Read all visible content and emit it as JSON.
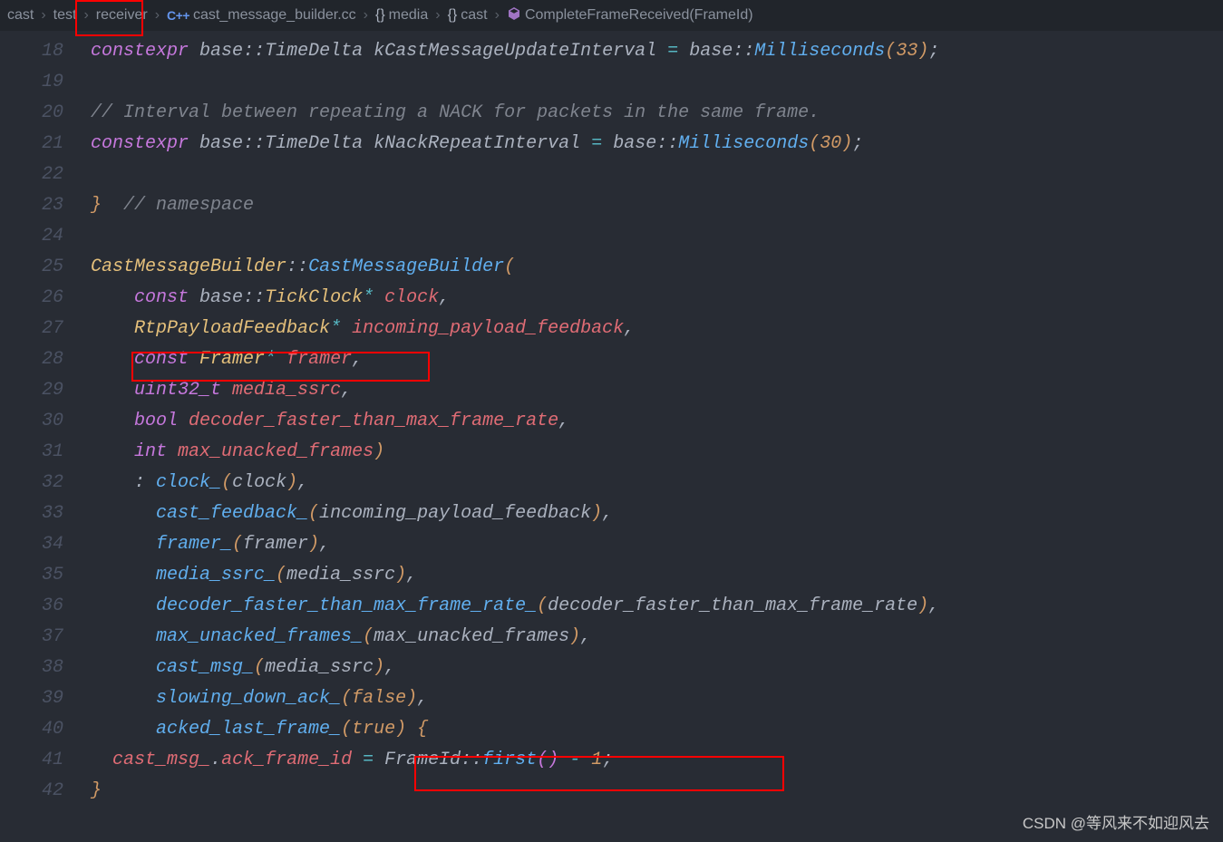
{
  "breadcrumb": {
    "items": [
      {
        "label": "cast",
        "icon": ""
      },
      {
        "label": "test",
        "icon": ""
      },
      {
        "label": "receiver",
        "icon": ""
      },
      {
        "label": "cast_message_builder.cc",
        "icon": "cpp"
      },
      {
        "label": "media",
        "icon": "brace"
      },
      {
        "label": "cast",
        "icon": "brace"
      },
      {
        "label": "CompleteFrameReceived(FrameId)",
        "icon": "cube"
      }
    ]
  },
  "lines": [
    {
      "num": "18",
      "tokens": [
        {
          "c": "kw",
          "t": "constexpr"
        },
        {
          "c": "punc",
          "t": " "
        },
        {
          "c": "plain",
          "t": "base"
        },
        {
          "c": "punc",
          "t": "::"
        },
        {
          "c": "plain",
          "t": "TimeDelta"
        },
        {
          "c": "punc",
          "t": " "
        },
        {
          "c": "plain",
          "t": "kCastMessageUpdateInterval"
        },
        {
          "c": "punc",
          "t": " "
        },
        {
          "c": "op",
          "t": "="
        },
        {
          "c": "punc",
          "t": " "
        },
        {
          "c": "plain",
          "t": "base"
        },
        {
          "c": "punc",
          "t": "::"
        },
        {
          "c": "func",
          "t": "Milliseconds"
        },
        {
          "c": "brace1",
          "t": "("
        },
        {
          "c": "num",
          "t": "33"
        },
        {
          "c": "brace1",
          "t": ")"
        },
        {
          "c": "punc",
          "t": ";"
        }
      ]
    },
    {
      "num": "19",
      "tokens": []
    },
    {
      "num": "20",
      "tokens": [
        {
          "c": "cmt",
          "t": "// Interval between repeating a NACK for packets in the same frame."
        }
      ]
    },
    {
      "num": "21",
      "tokens": [
        {
          "c": "kw",
          "t": "constexpr"
        },
        {
          "c": "punc",
          "t": " "
        },
        {
          "c": "plain",
          "t": "base"
        },
        {
          "c": "punc",
          "t": "::"
        },
        {
          "c": "plain",
          "t": "TimeDelta"
        },
        {
          "c": "punc",
          "t": " "
        },
        {
          "c": "plain",
          "t": "kNackRepeatInterval"
        },
        {
          "c": "punc",
          "t": " "
        },
        {
          "c": "op",
          "t": "="
        },
        {
          "c": "punc",
          "t": " "
        },
        {
          "c": "plain",
          "t": "base"
        },
        {
          "c": "punc",
          "t": "::"
        },
        {
          "c": "func",
          "t": "Milliseconds"
        },
        {
          "c": "brace1",
          "t": "("
        },
        {
          "c": "num",
          "t": "30"
        },
        {
          "c": "brace1",
          "t": ")"
        },
        {
          "c": "punc",
          "t": ";"
        }
      ]
    },
    {
      "num": "22",
      "tokens": []
    },
    {
      "num": "23",
      "tokens": [
        {
          "c": "brace1",
          "t": "}"
        },
        {
          "c": "punc",
          "t": "  "
        },
        {
          "c": "cmt",
          "t": "// namespace"
        }
      ]
    },
    {
      "num": "24",
      "tokens": []
    },
    {
      "num": "25",
      "tokens": [
        {
          "c": "type",
          "t": "CastMessageBuilder"
        },
        {
          "c": "punc",
          "t": "::"
        },
        {
          "c": "func",
          "t": "CastMessageBuilder"
        },
        {
          "c": "brace1",
          "t": "("
        }
      ]
    },
    {
      "num": "26",
      "tokens": [
        {
          "c": "punc",
          "t": "    "
        },
        {
          "c": "kw",
          "t": "const"
        },
        {
          "c": "punc",
          "t": " "
        },
        {
          "c": "plain",
          "t": "base"
        },
        {
          "c": "punc",
          "t": "::"
        },
        {
          "c": "type",
          "t": "TickClock"
        },
        {
          "c": "op",
          "t": "*"
        },
        {
          "c": "punc",
          "t": " "
        },
        {
          "c": "var",
          "t": "clock"
        },
        {
          "c": "punc",
          "t": ","
        }
      ]
    },
    {
      "num": "27",
      "tokens": [
        {
          "c": "punc",
          "t": "    "
        },
        {
          "c": "type",
          "t": "RtpPayloadFeedback"
        },
        {
          "c": "op",
          "t": "*"
        },
        {
          "c": "punc",
          "t": " "
        },
        {
          "c": "var",
          "t": "incoming_payload_feedback"
        },
        {
          "c": "punc",
          "t": ","
        }
      ]
    },
    {
      "num": "28",
      "tokens": [
        {
          "c": "punc",
          "t": "    "
        },
        {
          "c": "kw",
          "t": "const"
        },
        {
          "c": "punc",
          "t": " "
        },
        {
          "c": "type",
          "t": "Framer"
        },
        {
          "c": "op",
          "t": "*"
        },
        {
          "c": "punc",
          "t": " "
        },
        {
          "c": "var",
          "t": "framer"
        },
        {
          "c": "punc",
          "t": ","
        }
      ]
    },
    {
      "num": "29",
      "tokens": [
        {
          "c": "punc",
          "t": "    "
        },
        {
          "c": "kw",
          "t": "uint32_t"
        },
        {
          "c": "punc",
          "t": " "
        },
        {
          "c": "var",
          "t": "media_ssrc"
        },
        {
          "c": "punc",
          "t": ","
        }
      ]
    },
    {
      "num": "30",
      "tokens": [
        {
          "c": "punc",
          "t": "    "
        },
        {
          "c": "kw",
          "t": "bool"
        },
        {
          "c": "punc",
          "t": " "
        },
        {
          "c": "var",
          "t": "decoder_faster_than_max_frame_rate"
        },
        {
          "c": "punc",
          "t": ","
        }
      ]
    },
    {
      "num": "31",
      "tokens": [
        {
          "c": "punc",
          "t": "    "
        },
        {
          "c": "kw",
          "t": "int"
        },
        {
          "c": "punc",
          "t": " "
        },
        {
          "c": "var",
          "t": "max_unacked_frames"
        },
        {
          "c": "brace1",
          "t": ")"
        }
      ]
    },
    {
      "num": "32",
      "tokens": [
        {
          "c": "punc",
          "t": "    "
        },
        {
          "c": "punc",
          "t": ":"
        },
        {
          "c": "punc",
          "t": " "
        },
        {
          "c": "func",
          "t": "clock_"
        },
        {
          "c": "brace1",
          "t": "("
        },
        {
          "c": "plain",
          "t": "clock"
        },
        {
          "c": "brace1",
          "t": ")"
        },
        {
          "c": "punc",
          "t": ","
        }
      ]
    },
    {
      "num": "33",
      "tokens": [
        {
          "c": "punc",
          "t": "      "
        },
        {
          "c": "func",
          "t": "cast_feedback_"
        },
        {
          "c": "brace1",
          "t": "("
        },
        {
          "c": "plain",
          "t": "incoming_payload_feedback"
        },
        {
          "c": "brace1",
          "t": ")"
        },
        {
          "c": "punc",
          "t": ","
        }
      ]
    },
    {
      "num": "34",
      "tokens": [
        {
          "c": "punc",
          "t": "      "
        },
        {
          "c": "func",
          "t": "framer_"
        },
        {
          "c": "brace1",
          "t": "("
        },
        {
          "c": "plain",
          "t": "framer"
        },
        {
          "c": "brace1",
          "t": ")"
        },
        {
          "c": "punc",
          "t": ","
        }
      ]
    },
    {
      "num": "35",
      "tokens": [
        {
          "c": "punc",
          "t": "      "
        },
        {
          "c": "func",
          "t": "media_ssrc_"
        },
        {
          "c": "brace1",
          "t": "("
        },
        {
          "c": "plain",
          "t": "media_ssrc"
        },
        {
          "c": "brace1",
          "t": ")"
        },
        {
          "c": "punc",
          "t": ","
        }
      ]
    },
    {
      "num": "36",
      "tokens": [
        {
          "c": "punc",
          "t": "      "
        },
        {
          "c": "func",
          "t": "decoder_faster_than_max_frame_rate_"
        },
        {
          "c": "brace1",
          "t": "("
        },
        {
          "c": "plain",
          "t": "decoder_faster_than_max_frame_rate"
        },
        {
          "c": "brace1",
          "t": ")"
        },
        {
          "c": "punc",
          "t": ","
        }
      ]
    },
    {
      "num": "37",
      "tokens": [
        {
          "c": "punc",
          "t": "      "
        },
        {
          "c": "func",
          "t": "max_unacked_frames_"
        },
        {
          "c": "brace1",
          "t": "("
        },
        {
          "c": "plain",
          "t": "max_unacked_frames"
        },
        {
          "c": "brace1",
          "t": ")"
        },
        {
          "c": "punc",
          "t": ","
        }
      ]
    },
    {
      "num": "38",
      "tokens": [
        {
          "c": "punc",
          "t": "      "
        },
        {
          "c": "func",
          "t": "cast_msg_"
        },
        {
          "c": "brace1",
          "t": "("
        },
        {
          "c": "plain",
          "t": "media_ssrc"
        },
        {
          "c": "brace1",
          "t": ")"
        },
        {
          "c": "punc",
          "t": ","
        }
      ]
    },
    {
      "num": "39",
      "tokens": [
        {
          "c": "punc",
          "t": "      "
        },
        {
          "c": "func",
          "t": "slowing_down_ack_"
        },
        {
          "c": "brace1",
          "t": "("
        },
        {
          "c": "bool",
          "t": "false"
        },
        {
          "c": "brace1",
          "t": ")"
        },
        {
          "c": "punc",
          "t": ","
        }
      ]
    },
    {
      "num": "40",
      "tokens": [
        {
          "c": "punc",
          "t": "      "
        },
        {
          "c": "func",
          "t": "acked_last_frame_"
        },
        {
          "c": "brace1",
          "t": "("
        },
        {
          "c": "bool",
          "t": "true"
        },
        {
          "c": "brace1",
          "t": ")"
        },
        {
          "c": "punc",
          "t": " "
        },
        {
          "c": "brace1",
          "t": "{"
        }
      ]
    },
    {
      "num": "41",
      "tokens": [
        {
          "c": "punc",
          "t": "  "
        },
        {
          "c": "var",
          "t": "cast_msg_"
        },
        {
          "c": "punc",
          "t": "."
        },
        {
          "c": "var",
          "t": "ack_frame_id"
        },
        {
          "c": "punc",
          "t": " "
        },
        {
          "c": "op",
          "t": "="
        },
        {
          "c": "punc",
          "t": " "
        },
        {
          "c": "plain",
          "t": "FrameId"
        },
        {
          "c": "punc",
          "t": "::"
        },
        {
          "c": "func",
          "t": "first"
        },
        {
          "c": "brace2",
          "t": "("
        },
        {
          "c": "brace2",
          "t": ")"
        },
        {
          "c": "punc",
          "t": " "
        },
        {
          "c": "op",
          "t": "-"
        },
        {
          "c": "punc",
          "t": " "
        },
        {
          "c": "num",
          "t": "1"
        },
        {
          "c": "punc",
          "t": ";"
        }
      ]
    },
    {
      "num": "42",
      "tokens": [
        {
          "c": "brace1",
          "t": "}"
        }
      ]
    }
  ],
  "watermark": "CSDN @等风来不如迎风去"
}
